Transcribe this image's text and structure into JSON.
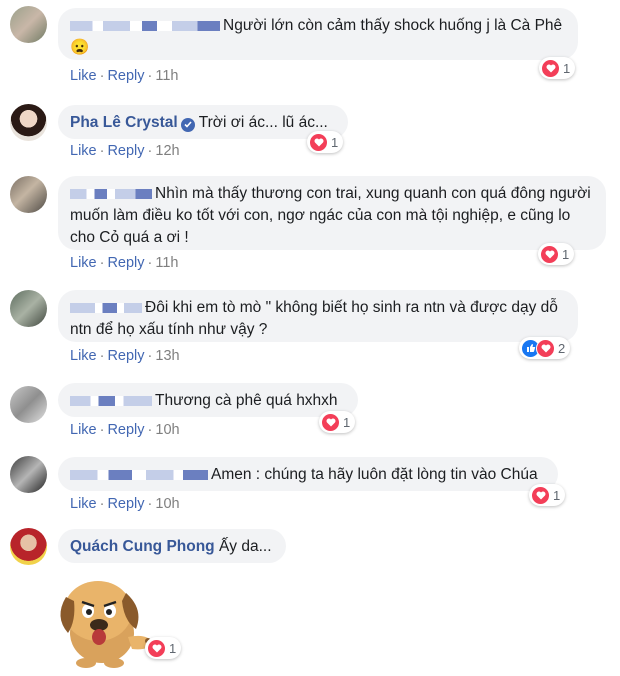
{
  "actions": {
    "like": "Like",
    "reply": "Reply",
    "separator": "·"
  },
  "colors": {
    "link": "#4267b2",
    "author": "#385898",
    "bubble": "#f2f3f5",
    "heart": "#f33e58",
    "like": "#1877f2"
  },
  "comments": [
    {
      "author": "",
      "text": "Người lớn còn cảm thấy shock huống j là Cà Phê",
      "emoji": "😦",
      "time": "11h",
      "reactions": [
        "heart"
      ],
      "count": "1"
    },
    {
      "author": "Pha Lê Crystal",
      "verified": true,
      "text": "Trời ơi ác... lũ ác...",
      "time": "12h",
      "reactions": [
        "heart"
      ],
      "count": "1"
    },
    {
      "author": "",
      "text": "Nhìn mà thấy thương con trai, xung quanh con quá đông người muốn làm điều ko tốt với con, ngơ ngác của con mà tội nghiệp, e cũng lo cho Cỏ quá a ơi !",
      "time": "11h",
      "reactions": [
        "heart"
      ],
      "count": "1"
    },
    {
      "author": "",
      "text": "Đôi khi em tò mò \" không biết họ sinh ra ntn và được dạy dỗ ntn để họ xấu tính như vậy ?",
      "time": "13h",
      "reactions": [
        "like",
        "heart"
      ],
      "count": "2"
    },
    {
      "author": "",
      "text": "Thương cà phê quá hxhxh",
      "time": "10h",
      "reactions": [
        "heart"
      ],
      "count": "1"
    },
    {
      "author": "",
      "text": "Amen : chúng ta hãy luôn đặt lòng tin vào Chúa",
      "time": "10h",
      "reactions": [
        "heart"
      ],
      "count": "1"
    },
    {
      "author": "Quách Cung Phong",
      "text": "Ấy da...",
      "sticker": "dog-sticker",
      "reactions": [
        "heart"
      ],
      "count": "1"
    }
  ]
}
